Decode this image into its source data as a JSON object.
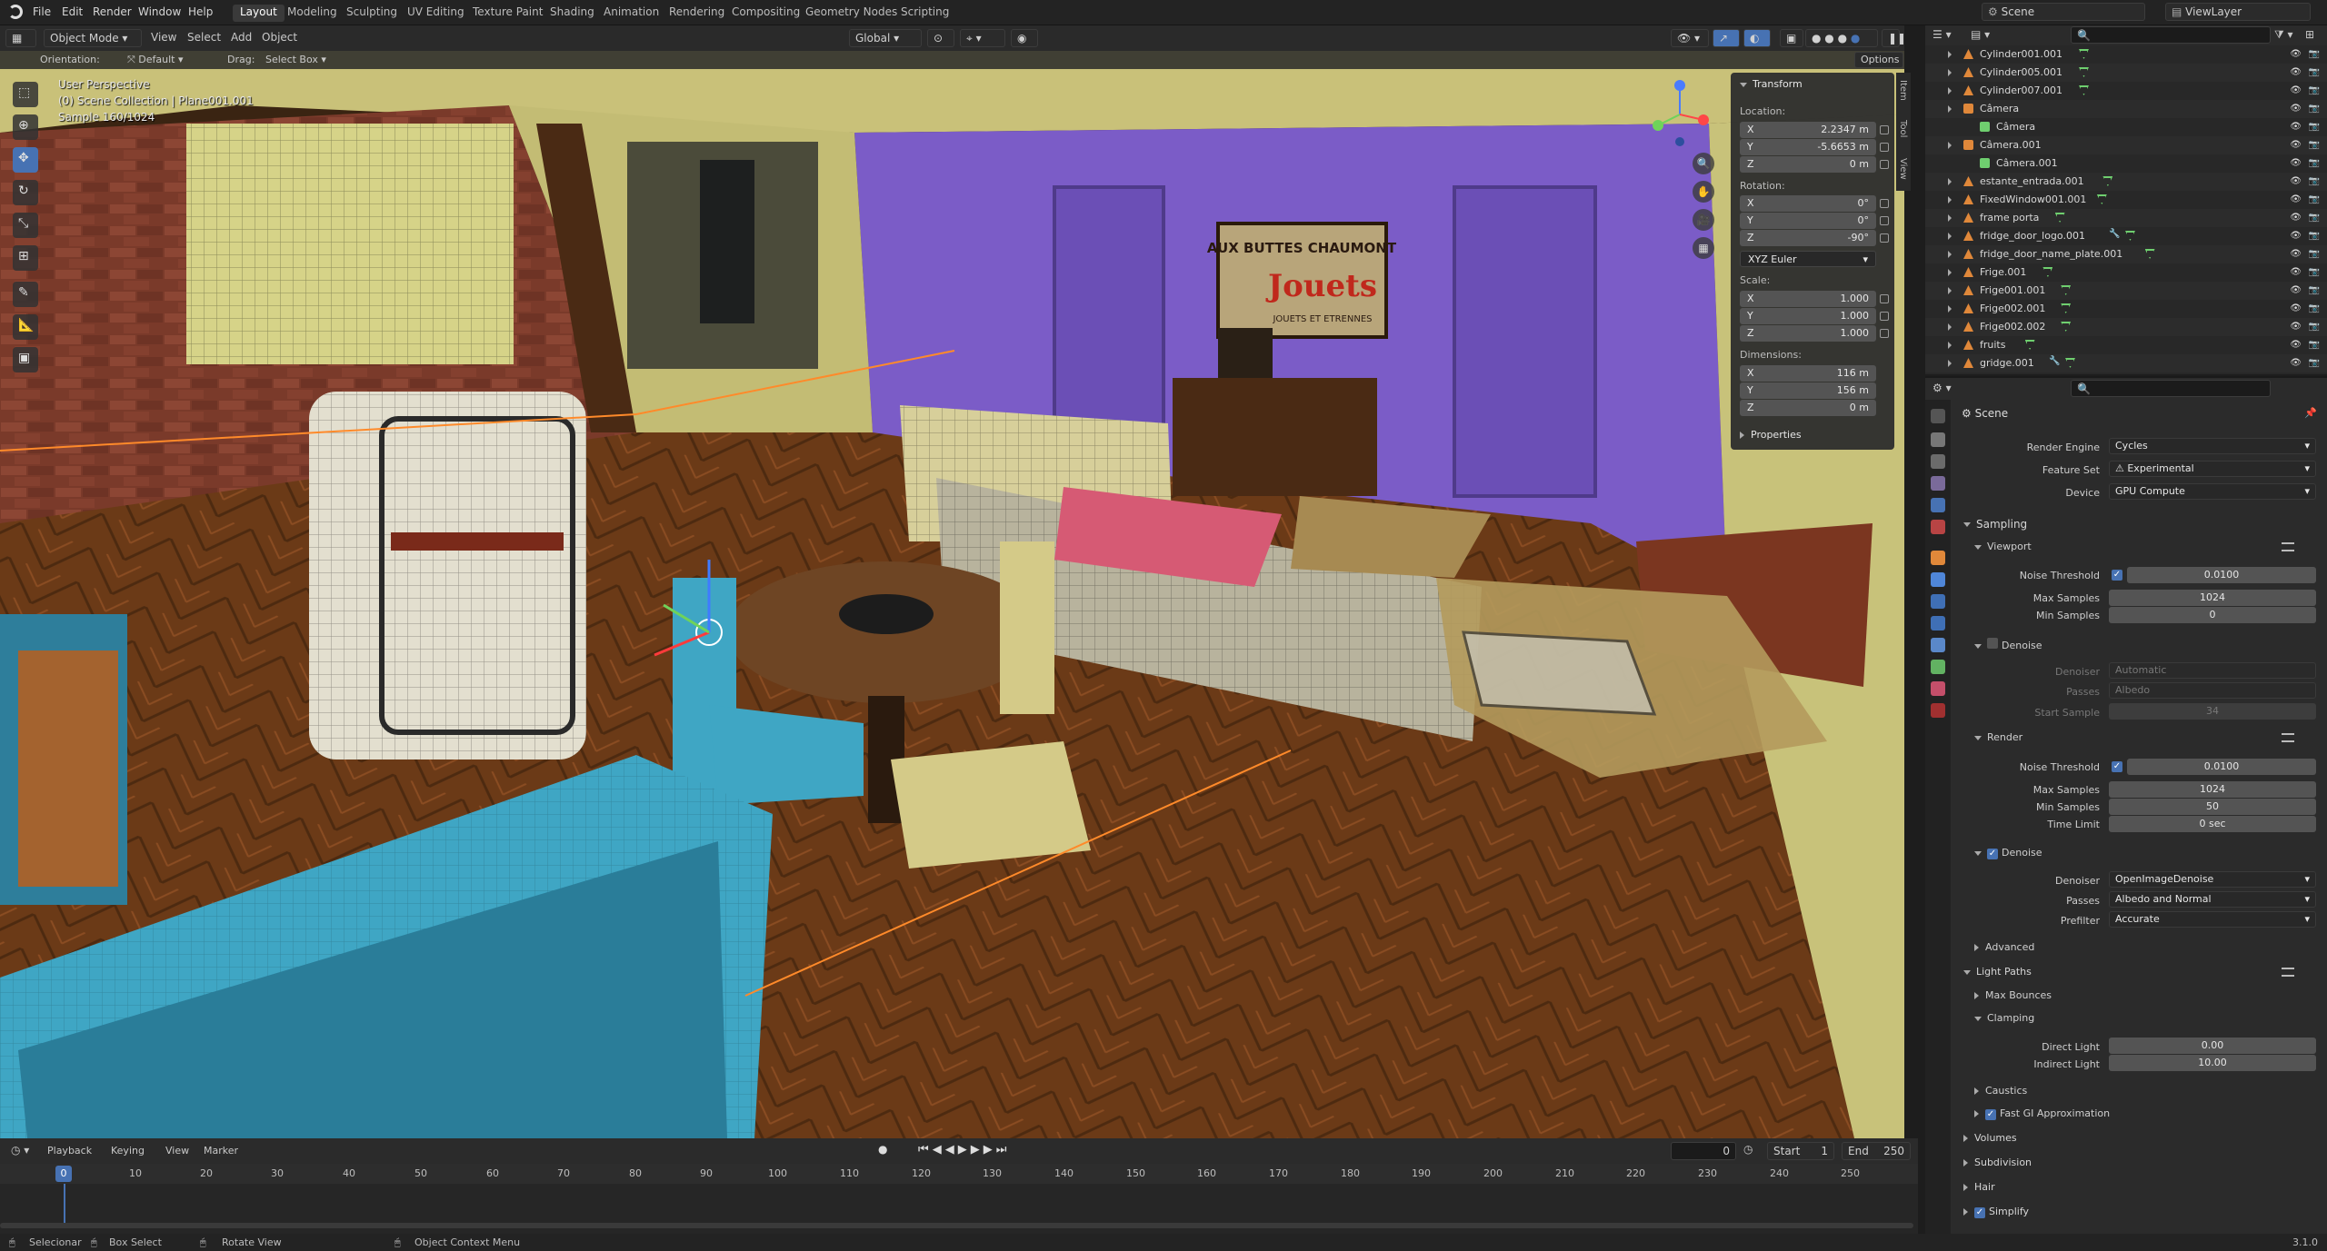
{
  "menu": {
    "items": [
      "File",
      "Edit",
      "Render",
      "Window",
      "Help"
    ]
  },
  "workspaces": [
    "Layout",
    "Modeling",
    "Sculpting",
    "UV Editing",
    "Texture Paint",
    "Shading",
    "Animation",
    "Rendering",
    "Compositing",
    "Geometry Nodes",
    "Scripting"
  ],
  "active_workspace": "Layout",
  "scene_field": "Scene",
  "viewlayer_field": "ViewLayer",
  "viewport_header": {
    "mode": "Object Mode",
    "menus": [
      "View",
      "Select",
      "Add",
      "Object"
    ],
    "transform": "Global"
  },
  "tool_settings": {
    "orientation_label": "Orientation:",
    "orientation_value": "Default",
    "drag_label": "Drag:",
    "drag_value": "Select Box",
    "options": "Options"
  },
  "overlay": {
    "line1": "User Perspective",
    "line2": "(0) Scene Collection | Plane001.001",
    "line3": "Sample 160/1024"
  },
  "npanel": {
    "title": "Transform",
    "location_label": "Location:",
    "location": [
      {
        "ax": "X",
        "v": "2.2347 m"
      },
      {
        "ax": "Y",
        "v": "-5.6653 m"
      },
      {
        "ax": "Z",
        "v": "0 m"
      }
    ],
    "rotation_label": "Rotation:",
    "rotation": [
      {
        "ax": "X",
        "v": "0°"
      },
      {
        "ax": "Y",
        "v": "0°"
      },
      {
        "ax": "Z",
        "v": "-90°"
      }
    ],
    "rotation_mode": "XYZ Euler",
    "scale_label": "Scale:",
    "scale": [
      {
        "ax": "X",
        "v": "1.000"
      },
      {
        "ax": "Y",
        "v": "1.000"
      },
      {
        "ax": "Z",
        "v": "1.000"
      }
    ],
    "dimensions_label": "Dimensions:",
    "dimensions": [
      {
        "ax": "X",
        "v": "116 m"
      },
      {
        "ax": "Y",
        "v": "156 m"
      },
      {
        "ax": "Z",
        "v": "0 m"
      }
    ],
    "properties": "Properties"
  },
  "sidetabs": [
    "Item",
    "Tool",
    "View"
  ],
  "scene_poster": {
    "line1": "AUX BUTTES CHAUMONT",
    "line2": "Jouets",
    "line3": "JOUETS ET ETRENNES"
  },
  "timeline": {
    "menus": [
      "Playback",
      "Keying",
      "View",
      "Marker"
    ],
    "current": "0",
    "start_label": "Start",
    "start": "1",
    "end_label": "End",
    "end": "250",
    "ticks": [
      "0",
      "10",
      "20",
      "30",
      "40",
      "50",
      "60",
      "70",
      "80",
      "90",
      "100",
      "110",
      "120",
      "130",
      "140",
      "150",
      "160",
      "170",
      "180",
      "190",
      "200",
      "210",
      "220",
      "230",
      "240",
      "250"
    ]
  },
  "status": {
    "select": "Selecionar",
    "box": "Box Select",
    "rotate": "Rotate View",
    "context": "Object Context Menu",
    "version": "3.1.0"
  },
  "outliner": {
    "rows": [
      {
        "name": "Cylinder001.001",
        "icon": "orange",
        "sub": false,
        "extra": "green"
      },
      {
        "name": "Cylinder005.001",
        "icon": "orange",
        "sub": false,
        "extra": "green"
      },
      {
        "name": "Cylinder007.001",
        "icon": "orange",
        "sub": false,
        "extra": "green"
      },
      {
        "name": "Câmera",
        "icon": "camera",
        "sub": false,
        "extra": ""
      },
      {
        "name": "Câmera",
        "icon": "camdata",
        "sub": true,
        "extra": ""
      },
      {
        "name": "Câmera.001",
        "icon": "camera",
        "sub": false,
        "extra": ""
      },
      {
        "name": "Câmera.001",
        "icon": "camdata",
        "sub": true,
        "extra": ""
      },
      {
        "name": "estante_entrada.001",
        "icon": "orange",
        "sub": false,
        "extra": "green"
      },
      {
        "name": "FixedWindow001.001",
        "icon": "orange",
        "sub": false,
        "extra": "green"
      },
      {
        "name": "frame porta",
        "icon": "orange",
        "sub": false,
        "extra": "green"
      },
      {
        "name": "fridge_door_logo.001",
        "icon": "orange",
        "sub": false,
        "extra": "wrench-green"
      },
      {
        "name": "fridge_door_name_plate.001",
        "icon": "orange",
        "sub": false,
        "extra": "green"
      },
      {
        "name": "Frige.001",
        "icon": "orange",
        "sub": false,
        "extra": "green"
      },
      {
        "name": "Frige001.001",
        "icon": "orange",
        "sub": false,
        "extra": "green"
      },
      {
        "name": "Frige002.001",
        "icon": "orange",
        "sub": false,
        "extra": "green"
      },
      {
        "name": "Frige002.002",
        "icon": "orange",
        "sub": false,
        "extra": "green"
      },
      {
        "name": "fruits",
        "icon": "orange",
        "sub": false,
        "extra": "green"
      },
      {
        "name": "gridge.001",
        "icon": "orange",
        "sub": false,
        "extra": "wrench-green"
      }
    ]
  },
  "properties": {
    "context": "Scene",
    "render_engine_label": "Render Engine",
    "render_engine": "Cycles",
    "feature_set_label": "Feature Set",
    "feature_set": "Experimental",
    "device_label": "Device",
    "device": "GPU Compute",
    "sampling": "Sampling",
    "viewport": "Viewport",
    "noise_threshold_label": "Noise Threshold",
    "vp_noise": "0.0100",
    "max_samples_label": "Max Samples",
    "vp_max": "1024",
    "min_samples_label": "Min Samples",
    "vp_min": "0",
    "denoise": "Denoise",
    "denoiser_label": "Denoiser",
    "vp_denoiser": "Automatic",
    "passes_label": "Passes",
    "vp_passes": "Albedo",
    "start_sample_label": "Start Sample",
    "vp_start": "34",
    "render": "Render",
    "r_noise": "0.0100",
    "r_max": "1024",
    "r_min": "50",
    "time_limit_label": "Time Limit",
    "r_time": "0 sec",
    "r_denoiser": "OpenImageDenoise",
    "r_passes": "Albedo and Normal",
    "prefilter_label": "Prefilter",
    "r_prefilter": "Accurate",
    "advanced": "Advanced",
    "light_paths": "Light Paths",
    "max_bounces": "Max Bounces",
    "clamping": "Clamping",
    "direct_light_label": "Direct Light",
    "direct_light": "0.00",
    "indirect_light_label": "Indirect Light",
    "indirect_light": "10.00",
    "caustics": "Caustics",
    "fast_gi": "Fast GI Approximation",
    "volumes": "Volumes",
    "subdivision": "Subdivision",
    "hair": "Hair",
    "simplify": "Simplify"
  },
  "colors": {
    "accent": "#4772b3",
    "wall_purple": "#7b5cc7",
    "wall_yellow": "#c8c27a",
    "counter_blue": "#3fa6c4",
    "floor": "#6b3a17"
  }
}
